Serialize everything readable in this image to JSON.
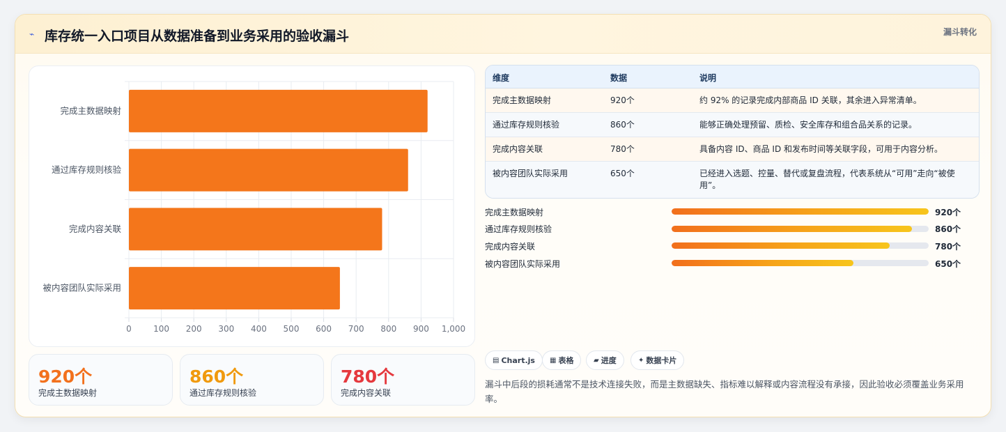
{
  "header": {
    "icon": "chart-line-icon",
    "title": "库存统一入口项目从数据准备到业务采用的验收漏斗",
    "tag": "漏斗转化"
  },
  "chart_data": {
    "type": "bar",
    "orientation": "horizontal",
    "categories": [
      "完成主数据映射",
      "通过库存规则核验",
      "完成内容关联",
      "被内容团队实际采用"
    ],
    "values": [
      920,
      860,
      780,
      650
    ],
    "xlim": [
      0,
      1000
    ],
    "xticks": [
      "0",
      "100",
      "200",
      "300",
      "400",
      "500",
      "600",
      "700",
      "800",
      "900",
      "1,000"
    ],
    "bar_color": "#f4761b",
    "grid": true
  },
  "kpis": [
    {
      "value": "920个",
      "label": "完成主数据映射",
      "color": "#f2711d"
    },
    {
      "value": "860个",
      "label": "通过库存规则核验",
      "color": "#f09a0e"
    },
    {
      "value": "780个",
      "label": "完成内容关联",
      "color": "#e5393e"
    }
  ],
  "table": {
    "headers": [
      "维度",
      "数据",
      "说明"
    ],
    "rows": [
      {
        "dim": "完成主数据映射",
        "val": "920个",
        "desc": "约 92% 的记录完成内部商品 ID 关联，其余进入异常清单。"
      },
      {
        "dim": "通过库存规则核验",
        "val": "860个",
        "desc": "能够正确处理预留、质检、安全库存和组合品关系的记录。"
      },
      {
        "dim": "完成内容关联",
        "val": "780个",
        "desc": "具备内容 ID、商品 ID 和发布时间等关联字段，可用于内容分析。"
      },
      {
        "dim": "被内容团队实际采用",
        "val": "650个",
        "desc": "已经进入选题、控量、替代或复盘流程，代表系统从“可用”走向“被使用”。"
      }
    ]
  },
  "progress": [
    {
      "label": "完成主数据映射",
      "value": "920个",
      "fraction": 1.0
    },
    {
      "label": "通过库存规则核验",
      "value": "860个",
      "fraction": 0.935
    },
    {
      "label": "完成内容关联",
      "value": "780个",
      "fraction": 0.848
    },
    {
      "label": "被内容团队实际采用",
      "value": "650个",
      "fraction": 0.7065
    }
  ],
  "chips": [
    {
      "icon": "chart-icon",
      "glyph": "▤",
      "label": "Chart.js"
    },
    {
      "icon": "table-icon",
      "glyph": "▦",
      "label": "表格"
    },
    {
      "icon": "progress-icon",
      "glyph": "▰",
      "label": "进度"
    },
    {
      "icon": "sparkle-icon",
      "glyph": "✦",
      "label": "数据卡片"
    }
  ],
  "note": "漏斗中后段的损耗通常不是技术连接失败，而是主数据缺失、指标难以解释或内容流程没有承接，因此验收必须覆盖业务采用率。"
}
